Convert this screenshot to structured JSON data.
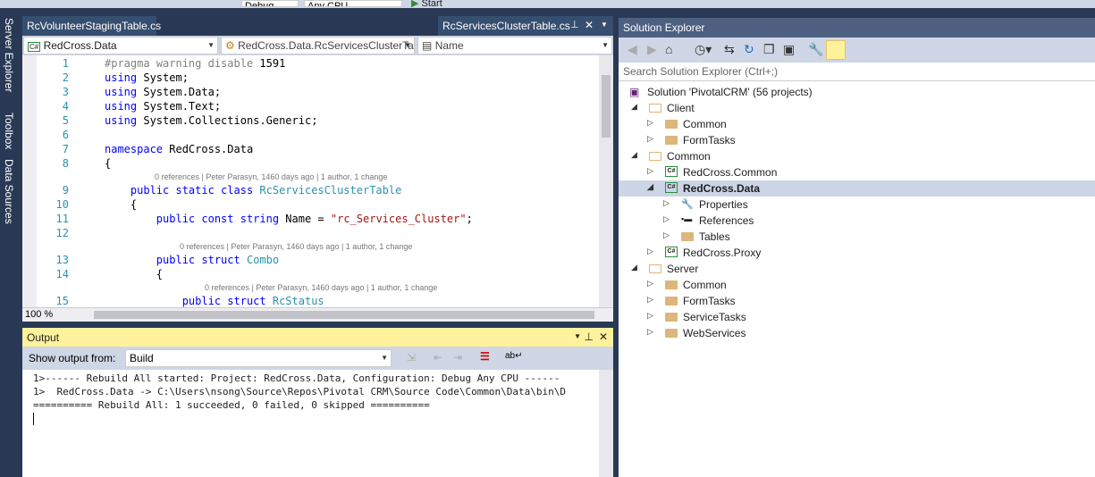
{
  "toolbar": {
    "config": "Debug",
    "platform": "Any CPU",
    "start": "Start"
  },
  "left_tabs": [
    "Server Explorer",
    "Toolbox",
    "Data Sources"
  ],
  "doc_tabs": [
    {
      "label": "RcVolunteerStagingTable.cs",
      "active": false
    },
    {
      "label": "RcServicesClusterTable.cs",
      "active": true
    }
  ],
  "nav": {
    "project": "RedCross.Data",
    "type": "RedCross.Data.RcServicesClusterTa",
    "member": "Name"
  },
  "code_lines": [
    {
      "n": "1",
      "seg": [
        [
          "#pragma warning disable ",
          "#808080"
        ],
        [
          "1591",
          "#000"
        ]
      ]
    },
    {
      "n": "2",
      "seg": [
        [
          "using ",
          "#0000ff"
        ],
        [
          "System;",
          "#000"
        ]
      ]
    },
    {
      "n": "3",
      "seg": [
        [
          "using ",
          "#0000ff"
        ],
        [
          "System.Data;",
          "#000"
        ]
      ]
    },
    {
      "n": "4",
      "seg": [
        [
          "using ",
          "#0000ff"
        ],
        [
          "System.Text;",
          "#000"
        ]
      ]
    },
    {
      "n": "5",
      "seg": [
        [
          "using ",
          "#0000ff"
        ],
        [
          "System.Collections.Generic;",
          "#000"
        ]
      ]
    },
    {
      "n": "6",
      "seg": []
    },
    {
      "n": "7",
      "seg": [
        [
          "namespace ",
          "#0000ff"
        ],
        [
          "RedCross.Data",
          "#000"
        ]
      ]
    },
    {
      "n": "8",
      "seg": [
        [
          "{",
          "#000"
        ]
      ]
    },
    {
      "lens": "0 references | Peter Parasyn, 1460 days ago | 1 author, 1 change",
      "indent": 1
    },
    {
      "n": "9",
      "seg": [
        [
          "    public static class ",
          "#0000ff"
        ],
        [
          "RcServicesClusterTable",
          "#2b91af"
        ]
      ]
    },
    {
      "n": "10",
      "seg": [
        [
          "    {",
          "#000"
        ]
      ]
    },
    {
      "n": "11",
      "seg": [
        [
          "        public const string ",
          "#0000ff"
        ],
        [
          "Name = ",
          "#000"
        ],
        [
          "\"rc_Services_Cluster\"",
          "#a31515"
        ],
        [
          ";",
          "#000"
        ]
      ]
    },
    {
      "n": "12",
      "seg": []
    },
    {
      "lens": "0 references | Peter Parasyn, 1460 days ago | 1 author, 1 change",
      "indent": 2
    },
    {
      "n": "13",
      "seg": [
        [
          "        public struct ",
          "#0000ff"
        ],
        [
          "Combo",
          "#2b91af"
        ]
      ]
    },
    {
      "n": "14",
      "seg": [
        [
          "        {",
          "#000"
        ]
      ]
    },
    {
      "lens": "0 references | Peter Parasyn, 1460 days ago | 1 author, 1 change",
      "indent": 3
    },
    {
      "n": "15",
      "seg": [
        [
          "            public struct ",
          "#0000ff"
        ],
        [
          "RcStatus",
          "#2b91af"
        ]
      ]
    }
  ],
  "editor": {
    "zoom": "100 %"
  },
  "output": {
    "title": "Output",
    "show_from_label": "Show output from:",
    "source": "Build",
    "lines": [
      "1>------ Rebuild All started: Project: RedCross.Data, Configuration: Debug Any CPU ------",
      "1>  RedCross.Data -> C:\\Users\\nsong\\Source\\Repos\\Pivotal CRM\\Source Code\\Common\\Data\\bin\\D",
      "========== Rebuild All: 1 succeeded, 0 failed, 0 skipped =========="
    ]
  },
  "solution_explorer": {
    "title": "Solution Explorer",
    "search_placeholder": "Search Solution Explorer (Ctrl+;)",
    "tree": [
      {
        "label": "Solution 'PivotalCRM' (56 projects)",
        "level": 0,
        "icon": "solution",
        "arrow": ""
      },
      {
        "label": "Client",
        "level": 1,
        "icon": "folder-open",
        "arrow": "expanded"
      },
      {
        "label": "Common",
        "level": 2,
        "icon": "folder",
        "arrow": "collapsed"
      },
      {
        "label": "FormTasks",
        "level": 2,
        "icon": "folder",
        "arrow": "collapsed"
      },
      {
        "label": "Common",
        "level": 1,
        "icon": "folder-open",
        "arrow": "expanded"
      },
      {
        "label": "RedCross.Common",
        "level": 2,
        "icon": "csproj",
        "arrow": "collapsed"
      },
      {
        "label": "RedCross.Data",
        "level": 2,
        "icon": "csproj",
        "arrow": "expanded",
        "selected": true
      },
      {
        "label": "Properties",
        "level": 3,
        "icon": "wrench",
        "arrow": "collapsed"
      },
      {
        "label": "References",
        "level": 3,
        "icon": "references",
        "arrow": "collapsed"
      },
      {
        "label": "Tables",
        "level": 3,
        "icon": "folder",
        "arrow": "collapsed"
      },
      {
        "label": "RedCross.Proxy",
        "level": 2,
        "icon": "csproj",
        "arrow": "collapsed"
      },
      {
        "label": "Server",
        "level": 1,
        "icon": "folder-open",
        "arrow": "expanded"
      },
      {
        "label": "Common",
        "level": 2,
        "icon": "folder",
        "arrow": "collapsed"
      },
      {
        "label": "FormTasks",
        "level": 2,
        "icon": "folder",
        "arrow": "collapsed"
      },
      {
        "label": "ServiceTasks",
        "level": 2,
        "icon": "folder",
        "arrow": "collapsed"
      },
      {
        "label": "WebServices",
        "level": 2,
        "icon": "folder",
        "arrow": "collapsed"
      }
    ]
  },
  "colors": {
    "chrome": "#293955",
    "output_header": "#fff29d",
    "selection": "#ccd5e6",
    "se_header": "#4d6082"
  }
}
